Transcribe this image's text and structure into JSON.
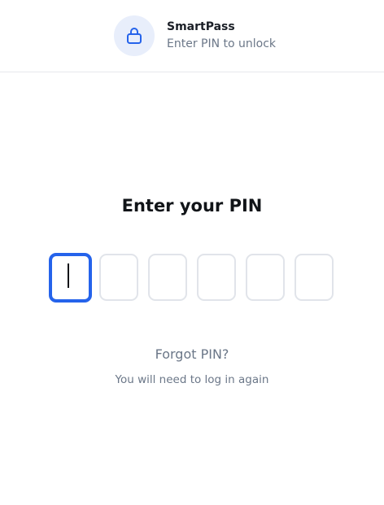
{
  "header": {
    "app_name": "SmartPass",
    "subtitle": "Enter PIN to unlock",
    "icon": "lock-icon"
  },
  "pin": {
    "title": "Enter your PIN",
    "length": 6,
    "digits": [
      "",
      "",
      "",
      "",
      "",
      ""
    ],
    "active_index": 0
  },
  "forgot": {
    "link_label": "Forgot PIN?",
    "note": "You will need to log in again"
  },
  "colors": {
    "accent": "#2563eb",
    "icon_bg": "#e8eefb",
    "muted_text": "#6b7788",
    "box_border": "#e1e4ea"
  }
}
